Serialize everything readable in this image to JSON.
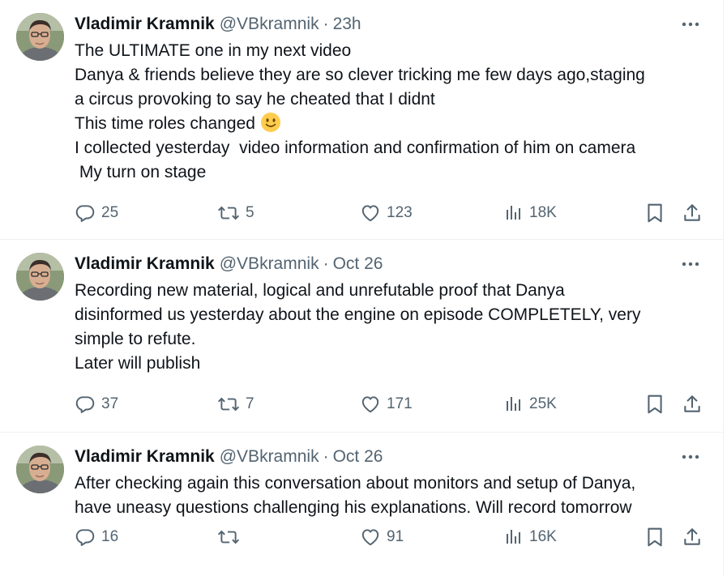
{
  "tweets": [
    {
      "name": "Vladimir Kramnik",
      "handle": "@VBkramnik",
      "separator": "·",
      "time": "23h",
      "lines": [
        "The ULTIMATE one in my next video",
        "Danya & friends believe they are so clever tricking me few days ago,staging",
        "a circus provoking to say he cheated that I didnt",
        "This time roles changed",
        "I collected yesterday  video information and confirmation of him on camera",
        " My turn on stage"
      ],
      "emoji": "slightly-smiling-face-emoji",
      "replies": "25",
      "retweets": "5",
      "likes": "123",
      "views": "18K"
    },
    {
      "name": "Vladimir Kramnik",
      "handle": "@VBkramnik",
      "separator": "·",
      "time": "Oct 26",
      "lines": [
        "Recording new material, logical and unrefutable proof that Danya",
        "disinformed us yesterday about the engine on episode COMPLETELY, very",
        "simple to refute.",
        "Later will publish"
      ],
      "replies": "37",
      "retweets": "7",
      "likes": "171",
      "views": "25K"
    },
    {
      "name": "Vladimir Kramnik",
      "handle": "@VBkramnik",
      "separator": "·",
      "time": "Oct 26",
      "lines": [
        "After checking again this conversation about monitors and setup of Danya,",
        "have uneasy questions challenging his explanations. Will record tomorrow"
      ],
      "replies": "16",
      "retweets": "",
      "likes": "91",
      "views": "16K"
    }
  ],
  "icons": {
    "more": "more-horizontal-icon",
    "reply": "reply-icon",
    "retweet": "retweet-icon",
    "like": "heart-icon",
    "views": "views-icon",
    "bookmark": "bookmark-icon",
    "share": "share-icon"
  },
  "colors": {
    "text": "#0f1419",
    "secondary": "#536471",
    "divider": "#eff3f4"
  }
}
